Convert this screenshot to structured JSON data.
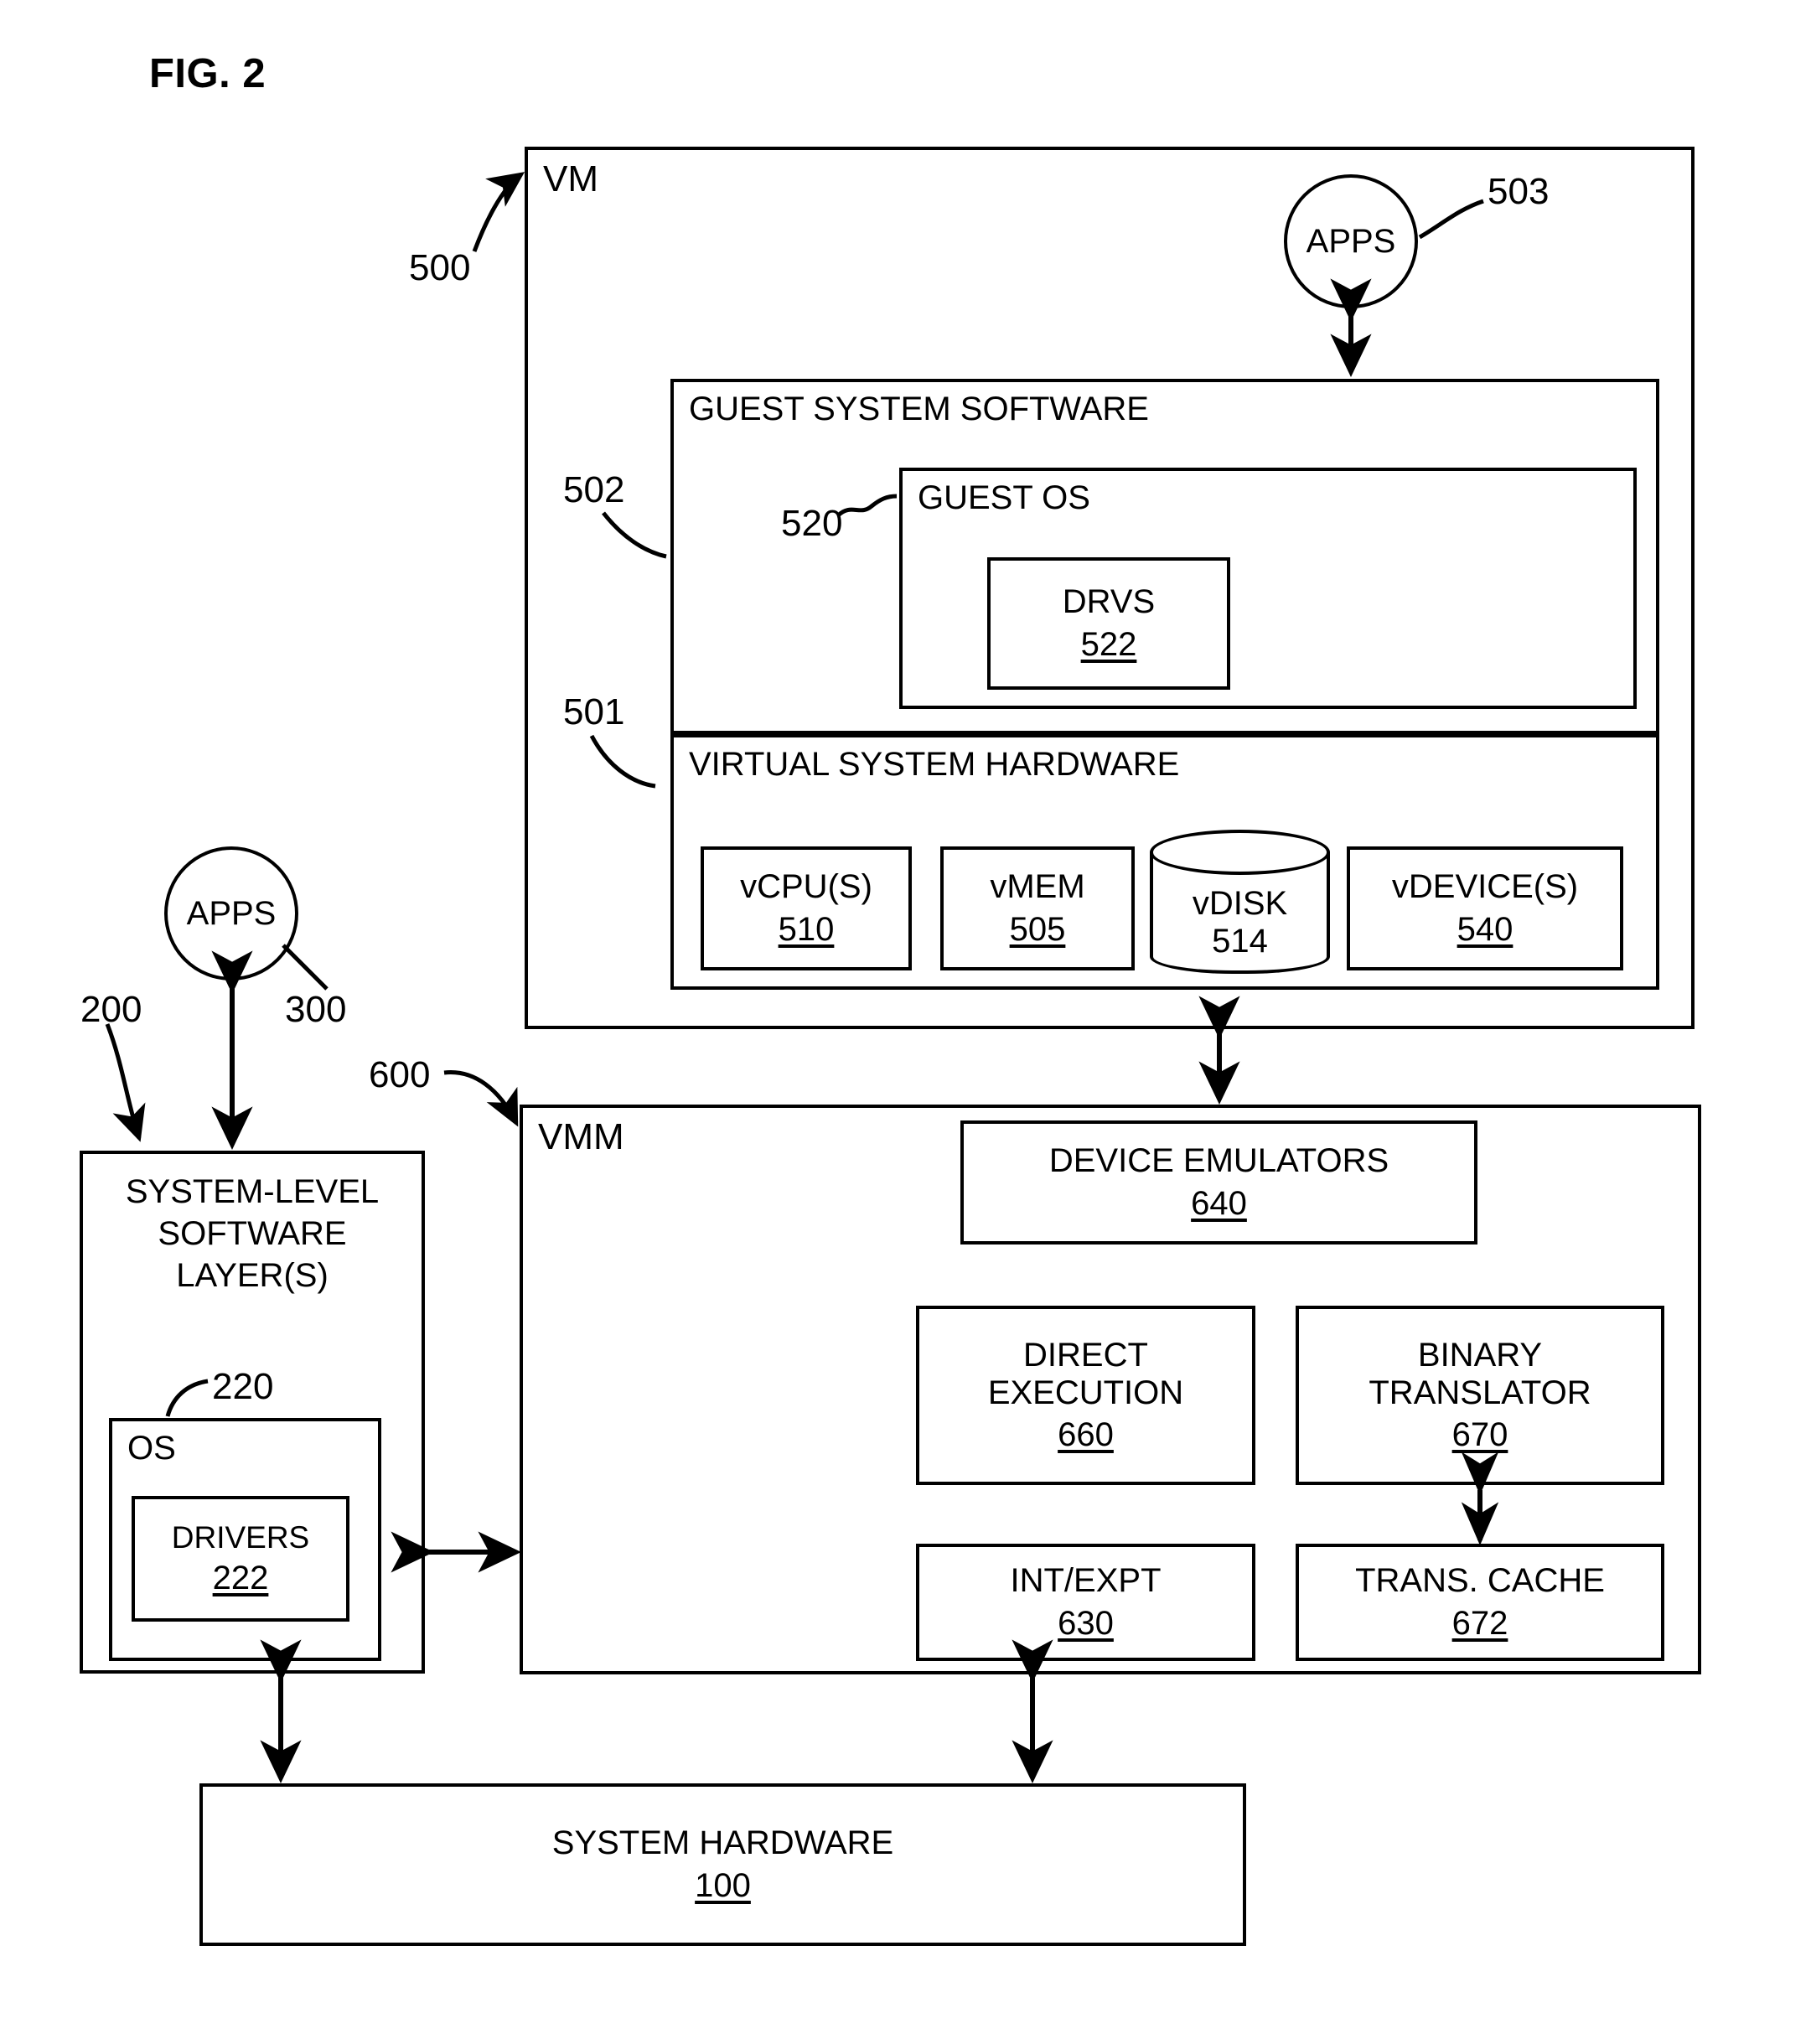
{
  "figure": {
    "title": "FIG. 2"
  },
  "vm": {
    "label": "VM",
    "ref": "500",
    "apps": {
      "label": "APPS",
      "ref": "503"
    },
    "guest_system_software": {
      "label": "GUEST SYSTEM SOFTWARE",
      "ref": "502",
      "guest_os": {
        "label": "GUEST OS",
        "ref": "520",
        "drvs": {
          "label": "DRVS",
          "ref": "522"
        }
      }
    },
    "virtual_system_hardware": {
      "label": "VIRTUAL SYSTEM HARDWARE",
      "ref": "501",
      "components": [
        {
          "label": "vCPU(S)",
          "ref": "510",
          "shape": "rect"
        },
        {
          "label": "vMEM",
          "ref": "505",
          "shape": "rect"
        },
        {
          "label": "vDISK",
          "ref": "514",
          "shape": "cylinder"
        },
        {
          "label": "vDEVICE(S)",
          "ref": "540",
          "shape": "rect"
        }
      ]
    }
  },
  "host": {
    "apps": {
      "label": "APPS",
      "ref": "300"
    },
    "system_level_software": {
      "label_lines": [
        "SYSTEM-LEVEL",
        "SOFTWARE",
        "LAYER(S)"
      ],
      "ref": "200",
      "os": {
        "label": "OS",
        "ref": "220",
        "drivers": {
          "label": "DRIVERS",
          "ref": "222"
        }
      }
    }
  },
  "vmm": {
    "label": "VMM",
    "ref": "600",
    "device_emulators": {
      "label": "DEVICE EMULATORS",
      "ref": "640"
    },
    "direct_execution": {
      "label_lines": [
        "DIRECT",
        "EXECUTION"
      ],
      "ref": "660"
    },
    "binary_translator": {
      "label_lines": [
        "BINARY",
        "TRANSLATOR"
      ],
      "ref": "670"
    },
    "int_expt": {
      "label": "INT/EXPT",
      "ref": "630"
    },
    "trans_cache": {
      "label": "TRANS. CACHE",
      "ref": "672"
    }
  },
  "system_hardware": {
    "label": "SYSTEM HARDWARE",
    "ref": "100"
  },
  "colors": {
    "ink": "#000000",
    "paper": "#ffffff"
  }
}
